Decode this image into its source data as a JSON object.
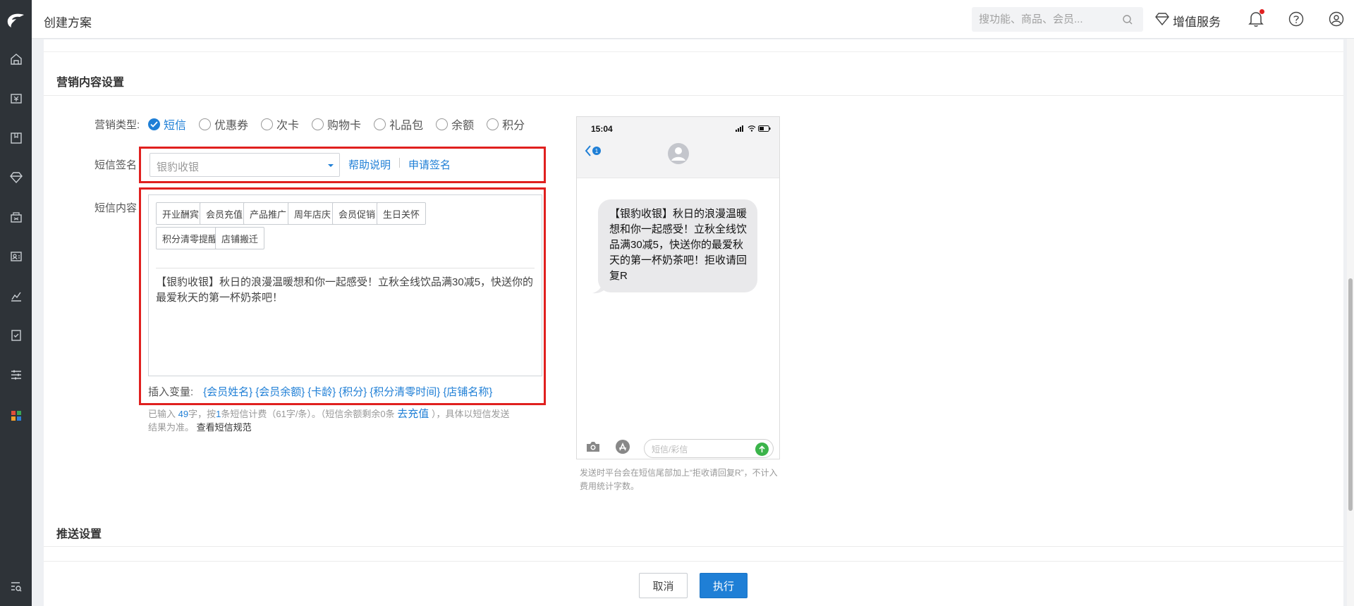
{
  "app": {
    "page_title": "创建方案",
    "search": {
      "placeholder": "搜功能、商品、会员..."
    },
    "vip_label": "增值服务"
  },
  "sidebar": {
    "icons": [
      "logo-icon",
      "home-icon",
      "cashier-icon",
      "goods-icon",
      "member-icon",
      "marketing-icon",
      "staff-icon",
      "report-icon",
      "audit-icon",
      "settings-icon",
      "apps-icon",
      "search-menu-icon"
    ]
  },
  "sections": {
    "content_title": "营销内容设置",
    "push_title": "推送设置"
  },
  "form": {
    "type_label": "营销类型:",
    "types": [
      {
        "label": "短信",
        "checked": true
      },
      {
        "label": "优惠券",
        "checked": false
      },
      {
        "label": "次卡",
        "checked": false
      },
      {
        "label": "购物卡",
        "checked": false
      },
      {
        "label": "礼品包",
        "checked": false
      },
      {
        "label": "余额",
        "checked": false
      },
      {
        "label": "积分",
        "checked": false
      }
    ],
    "signature_label": "短信签名",
    "signature_value": "银豹收银",
    "help_link": "帮助说明",
    "apply_link": "申请签名",
    "content_label": "短信内容",
    "templates": [
      "开业酬宾",
      "会员充值",
      "产品推广",
      "周年店庆",
      "会员促销",
      "生日关怀",
      "积分清零提醒",
      "店铺搬迁"
    ],
    "content_text": "【银豹收银】秋日的浪漫温暖想和你一起感受！立秋全线饮品满30减5，快送你的最爱秋天的第一杯奶茶吧！",
    "insert_label": "插入变量:",
    "variables": [
      "{会员姓名}",
      "{会员余额}",
      "{卡龄}",
      "{积分}",
      "{积分清零时间}",
      "{店铺名称}"
    ],
    "hint_prefix": "已输入",
    "hint_count": "49",
    "hint_mid1": "字，按",
    "hint_sms": "1",
    "hint_mid2": "条短信计费（61字/条）。（短信余额剩余0条",
    "hint_recharge": "去充值",
    "hint_suffix": "），具体以短信发送",
    "hint_line2": "结果为准。",
    "hint_rule": "查看短信规范"
  },
  "preview": {
    "time": "15:04",
    "back_badge": "1",
    "message": "【银豹收银】秋日的浪漫温暖想和你一起感受！立秋全线饮品满30减5，快送你的最爱秋天的第一杯奶茶吧！拒收请回复R",
    "input_placeholder": "短信/彩信",
    "note": "发送时平台会在短信尾部加上“拒收请回复R”，不计入费用统计字数。"
  },
  "footer": {
    "cancel": "取消",
    "execute": "执行"
  },
  "colors": {
    "accent": "#1f7fd6",
    "highlight_box": "#e0201f",
    "sidebar_bg": "#2e3338"
  }
}
